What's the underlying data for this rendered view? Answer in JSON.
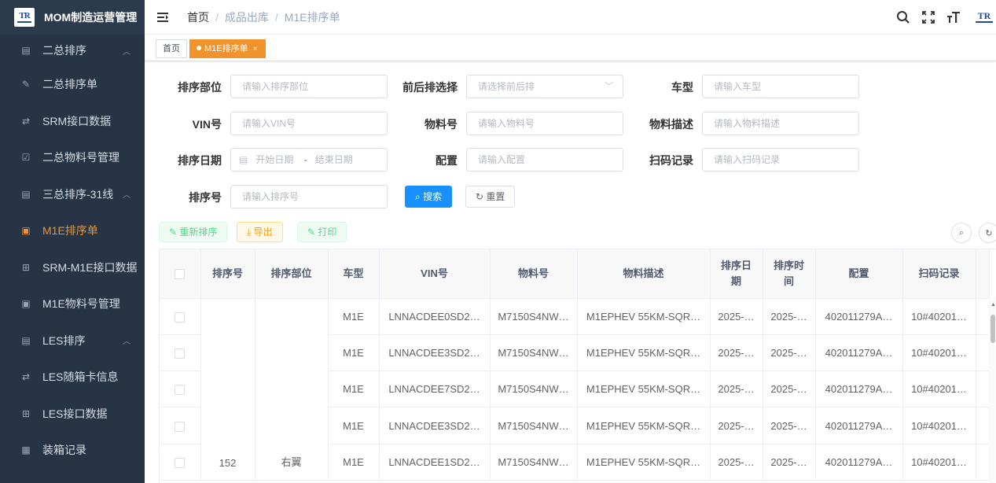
{
  "app": {
    "title": "MOM制造运营管理",
    "logo_text": "TR"
  },
  "sidebar": {
    "items": [
      {
        "label": "二总排序",
        "type": "parent",
        "icon": "list-icon"
      },
      {
        "label": "二总排序单",
        "type": "child",
        "icon": "edit-icon"
      },
      {
        "label": "SRM接口数据",
        "type": "child",
        "icon": "interface-icon"
      },
      {
        "label": "二总物料号管理",
        "type": "child",
        "icon": "checkbox-icon"
      },
      {
        "label": "三总排序-31线",
        "type": "parent",
        "icon": "list-icon"
      },
      {
        "label": "M1E排序单",
        "type": "child-active",
        "icon": "form-icon"
      },
      {
        "label": "SRM-M1E接口数据",
        "type": "child",
        "icon": "table-icon"
      },
      {
        "label": "M1E物料号管理",
        "type": "child",
        "icon": "form-icon"
      },
      {
        "label": "LES排序",
        "type": "parent",
        "icon": "list-icon"
      },
      {
        "label": "LES随箱卡信息",
        "type": "child",
        "icon": "interface-icon"
      },
      {
        "label": "LES接口数据",
        "type": "child",
        "icon": "table-icon"
      },
      {
        "label": "装箱记录",
        "type": "child",
        "icon": "record-icon"
      }
    ]
  },
  "header": {
    "breadcrumb": {
      "home": "首页",
      "parent": "成品出库",
      "current": "M1E排序单"
    },
    "sep": "/"
  },
  "tags": {
    "home": "首页",
    "active": "M1E排序单",
    "close": "×"
  },
  "search": {
    "dept_label": "排序部位",
    "dept_ph": "请输入排序部位",
    "fb_label": "前后排选择",
    "fb_ph": "请选择前后排",
    "model_label": "车型",
    "model_ph": "请输入车型",
    "vin_label": "VIN号",
    "vin_ph": "请输入VIN号",
    "mat_label": "物料号",
    "mat_ph": "请输入物料号",
    "matdesc_label": "物料描述",
    "matdesc_ph": "请输入物料描述",
    "date_label": "排序日期",
    "date_start": "开始日期",
    "date_sep": "-",
    "date_end": "结束日期",
    "config_label": "配置",
    "config_ph": "请输入配置",
    "scan_label": "扫码记录",
    "scan_ph": "请输入扫码记录",
    "seq_label": "排序号",
    "seq_ph": "请输入排序号",
    "search_btn": "搜索",
    "reset_btn": "重置"
  },
  "toolbar": {
    "resort": "重新排序",
    "export": "导出",
    "print": "打印"
  },
  "table": {
    "headers": [
      "排序号",
      "排序部位",
      "车型",
      "VIN号",
      "物料号",
      "物料描述",
      "排序日期",
      "排序时间",
      "配置",
      "扫码记录"
    ],
    "merged_seq": "152",
    "merged_dept": "右翼",
    "rows": [
      {
        "model": "M1E",
        "vin": "LNNACDEE0SD2…",
        "mat": "M7150S4NW…",
        "desc": "M1EPHEV 55KM-SQR…",
        "date": "2025-…",
        "time": "2025-…",
        "config": "402011279A…",
        "scan": "10#40201…"
      },
      {
        "model": "M1E",
        "vin": "LNNACDEE3SD2…",
        "mat": "M7150S4NW…",
        "desc": "M1EPHEV 55KM-SQR…",
        "date": "2025-…",
        "time": "2025-…",
        "config": "402011279A…",
        "scan": "10#40201…"
      },
      {
        "model": "M1E",
        "vin": "LNNACDEE7SD2…",
        "mat": "M7150S4NW…",
        "desc": "M1EPHEV 55KM-SQR…",
        "date": "2025-…",
        "time": "2025-…",
        "config": "402011279A…",
        "scan": "10#40201…"
      },
      {
        "model": "M1E",
        "vin": "LNNACDEE3SD2…",
        "mat": "M7150S4NW…",
        "desc": "M1EPHEV 55KM-SQR…",
        "date": "2025-…",
        "time": "2025-…",
        "config": "402011279A…",
        "scan": "10#40201…"
      },
      {
        "model": "M1E",
        "vin": "LNNACDEE1SD2…",
        "mat": "M7150S4NW…",
        "desc": "M1EPHEV 55KM-SQR…",
        "date": "2025-…",
        "time": "2025-…",
        "config": "402011279A…",
        "scan": "10#40201…"
      }
    ]
  },
  "colors": {
    "accent": "#f0932b",
    "primary": "#1890ff",
    "sidebar_bg": "#263445"
  }
}
